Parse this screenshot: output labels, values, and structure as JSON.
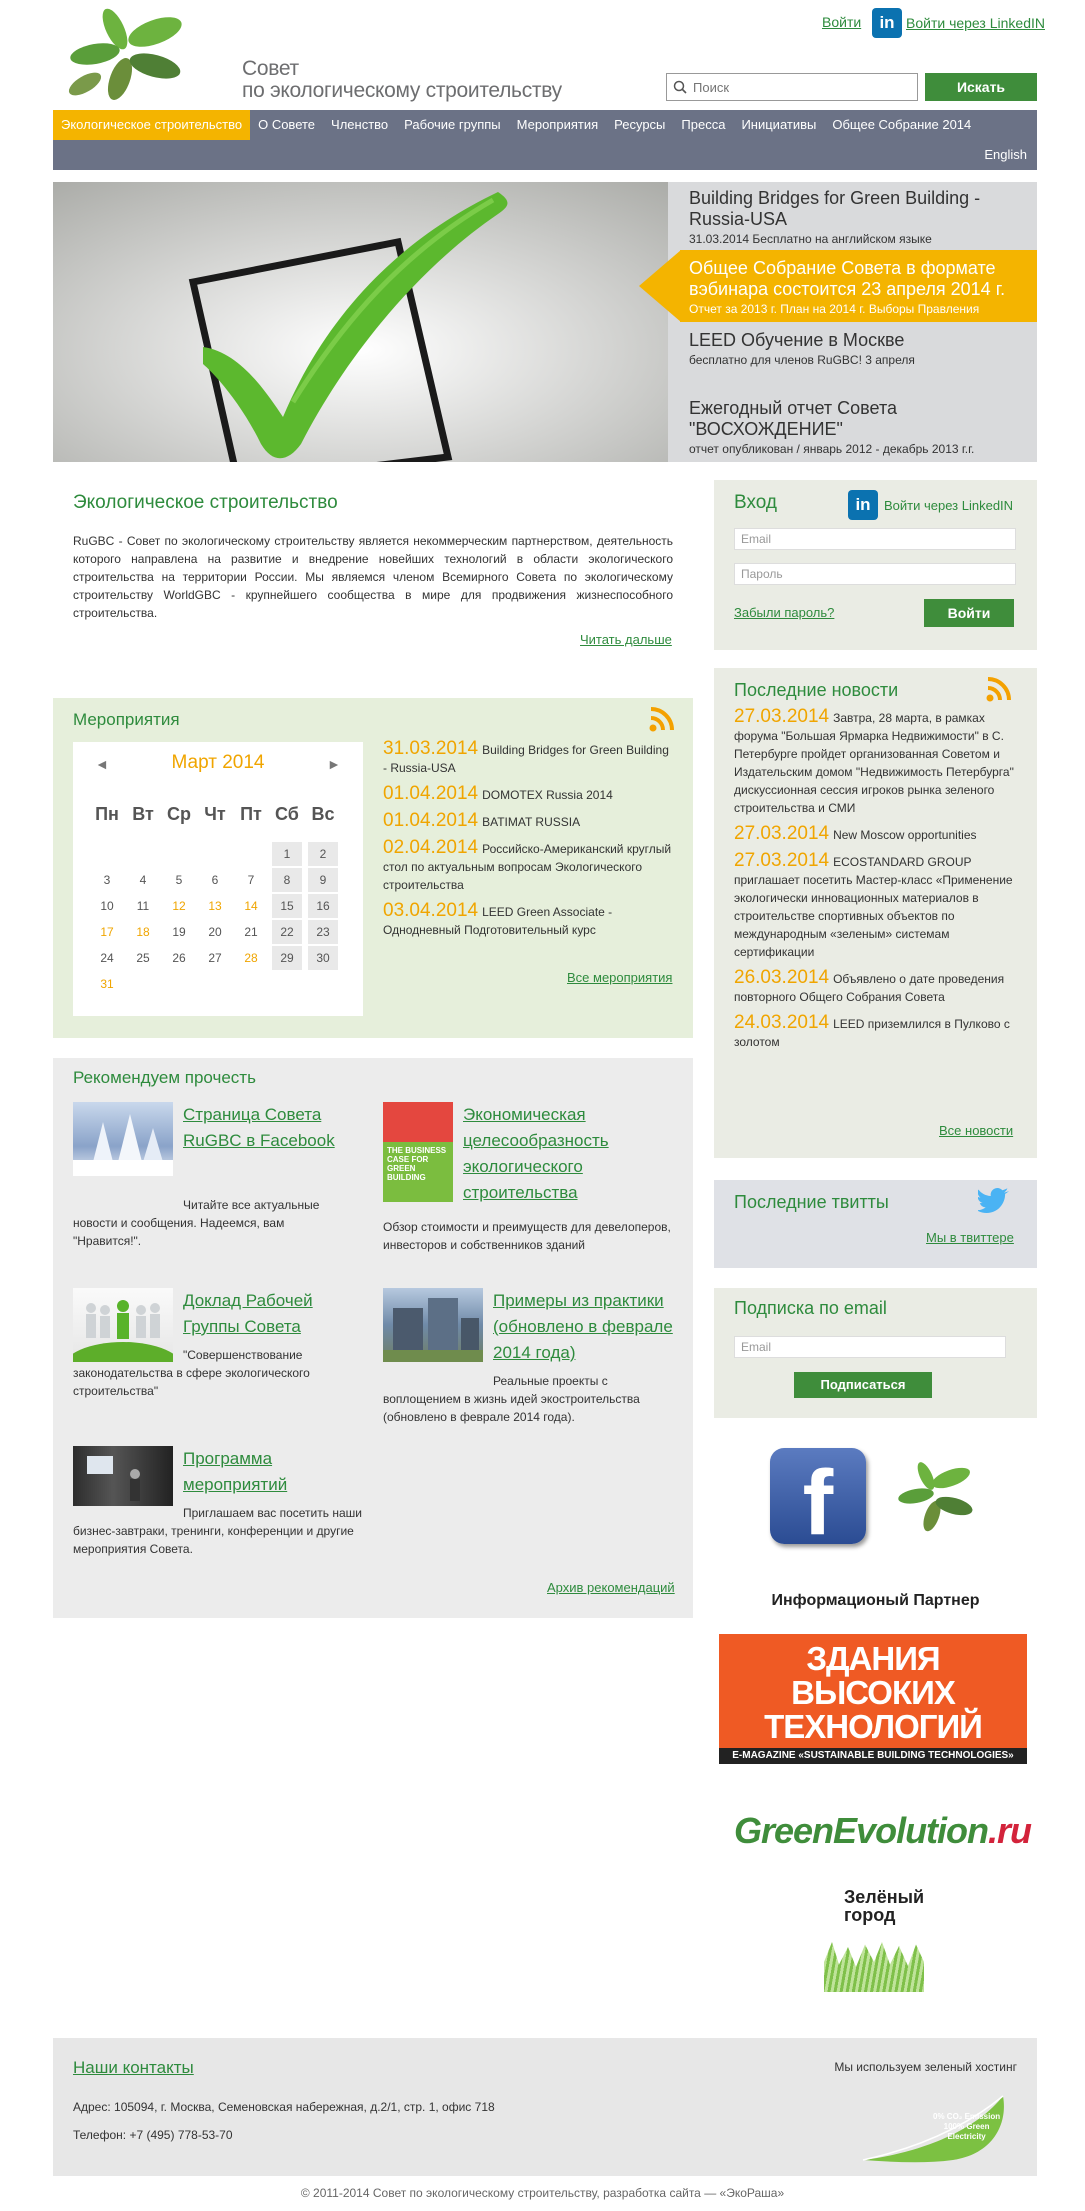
{
  "header": {
    "logo_line1": "Совет",
    "logo_line2": "по экологическому строительству",
    "login_link": "Войти",
    "linkedin_link": "Войти через LinkedIN",
    "linkedin_badge": "in",
    "search_placeholder": "Поиск",
    "search_button": "Искать"
  },
  "nav": {
    "items": [
      {
        "label": "Экологическое строительство",
        "active": true
      },
      {
        "label": "О Совете"
      },
      {
        "label": "Членство"
      },
      {
        "label": "Рабочие группы"
      },
      {
        "label": "Мероприятия"
      },
      {
        "label": "Ресурсы"
      },
      {
        "label": "Пресса"
      },
      {
        "label": "Инициативы"
      },
      {
        "label": "Общее Собрание 2014"
      }
    ],
    "english": "English"
  },
  "banner": {
    "items": [
      {
        "title": "Building Bridges for Green Building - Russia-USA",
        "sub": "31.03.2014 Бесплатно на английском языке"
      },
      {
        "title": "Общее Собрание Совета в формате вэбинара состоится 23 апреля 2014 г.",
        "sub": "Отчет за 2013 г. План на 2014 г. Выборы Правления"
      },
      {
        "title": "LEED Обучение в Москве",
        "sub": "бесплатно для членов RuGBC! 3 апреля"
      },
      {
        "title": "Ежегодный отчет Совета \"ВОСХОЖДЕНИЕ\"",
        "sub": "отчет опубликован / январь 2012 - декабрь 2013 г.г."
      }
    ]
  },
  "about": {
    "title": "Экологическое строительство",
    "text": "RuGBC - Совет по экологическому строительству является некоммерческим партнерством, деятельность которого направлена на развитие и внедрение новейших технологий в области экологического строительства на территории России. Мы являемся членом Всемирного Совета по экологическому строительству WorldGBC - крупнейшего сообщества в мире для продвижения жизнеспособного строительства.",
    "read_more": "Читать дальше"
  },
  "login": {
    "title": "Вход",
    "linkedin": "Войти через LinkedIN",
    "email_placeholder": "Email",
    "password_placeholder": "Пароль",
    "forgot": "Забыли пароль?",
    "button": "Войти"
  },
  "events": {
    "title": "Мероприятия",
    "calendar": {
      "month": "Март 2014",
      "prev": "◄",
      "next": "►",
      "dow": [
        "Пн",
        "Вт",
        "Ср",
        "Чт",
        "Пт",
        "Сб",
        "Вс"
      ],
      "weeks": [
        [
          "",
          "",
          "",
          "",
          "",
          "1",
          "2"
        ],
        [
          "3",
          "4",
          "5",
          "6",
          "7",
          "8",
          "9"
        ],
        [
          "10",
          "11",
          "12",
          "13",
          "14",
          "15",
          "16"
        ],
        [
          "17",
          "18",
          "19",
          "20",
          "21",
          "22",
          "23"
        ],
        [
          "24",
          "25",
          "26",
          "27",
          "28",
          "29",
          "30"
        ],
        [
          "31",
          "",
          "",
          "",
          "",
          "",
          ""
        ]
      ],
      "event_days": [
        "12",
        "13",
        "14",
        "17",
        "18",
        "28",
        "31"
      ]
    },
    "list": [
      {
        "date": "31.03.2014",
        "text": "Building Bridges for Green Building - Russia-USA"
      },
      {
        "date": "01.04.2014",
        "text": "DOMOTEX Russia 2014"
      },
      {
        "date": "01.04.2014",
        "text": "BATIMAT RUSSIA"
      },
      {
        "date": "02.04.2014",
        "text": "Российско-Американский круглый стол по актуальным вопросам Экологического строительства"
      },
      {
        "date": "03.04.2014",
        "text": "LEED Green Associate - Однодневный Подготовительный курс"
      }
    ],
    "all": "Все мероприятия"
  },
  "news": {
    "title": "Последние новости",
    "items": [
      {
        "date": "27.03.2014",
        "text": "Завтра, 28 марта, в рамках форума \"Большая Ярмарка Недвижимости\" в С. Петербурге пройдет организованная Советом и Издательским домом \"Недвижимость Петербурга\" дискуссионная сессия игроков рынка зеленого строительства и СМИ"
      },
      {
        "date": "27.03.2014",
        "text": "New Moscow opportunities"
      },
      {
        "date": "27.03.2014",
        "text": "ECOSTANDARD GROUP приглашает посетить Мастер-класс «Применение экологически инновационных материалов в строительстве спортивных объектов по международным «зеленым» системам сертификации"
      },
      {
        "date": "26.03.2014",
        "text": "Объявлено о дате проведения повторного Общего Собрания Совета"
      },
      {
        "date": "24.03.2014",
        "text": "LEED приземлился в Пулково с золотом"
      }
    ],
    "all": "Все новости"
  },
  "tweets": {
    "title": "Последние твитты",
    "link": "Мы в твиттере"
  },
  "subscribe": {
    "title": "Подписка по email",
    "email_placeholder": "Email",
    "button": "Подписаться"
  },
  "recommend": {
    "title": "Рекомендуем прочесть",
    "items": [
      {
        "link": "Страница Совета RuGBC в Facebook",
        "desc": "Читайте все актуальные новости и сообщения. Надеемся, вам \"Нравится!\"."
      },
      {
        "link": "Экономическая целесообразность экологического строительства",
        "desc": "Обзор стоимости и преимуществ для девелоперов, инвесторов и собственников зданий"
      },
      {
        "link": "Доклад Рабочей Группы Совета",
        "desc": "\"Совершенствование законодательства в сфере экологического строительства\""
      },
      {
        "link": "Примеры из практики (обновлено в феврале 2014 года)",
        "desc": "Реальные проекты с воплощением в жизнь идей экостроительства (обновлено в феврале 2014 года)."
      },
      {
        "link": "Программа мероприятий",
        "desc": "Приглашаем вас посетить наши бизнес-завтраки, тренинги, конференции и другие мероприятия Совета."
      }
    ],
    "book_cover_text": "THE BUSINESS CASE FOR GREEN BUILDING",
    "archive": "Архив рекомендаций"
  },
  "partners": {
    "facebook_glyph": "f",
    "info_partner": "Информационый Партнер",
    "zvt_line1": "ЗДАНИЯ",
    "zvt_line2": "ВЫСОКИХ",
    "zvt_line3": "ТЕХНОЛОГИЙ",
    "zvt_bar": "E-MAGAZINE «SUSTAINABLE BUILDING TECHNOLOGIES»",
    "ge_part1": "GreenEvolution",
    "ge_part2": ".ru",
    "zg_line1": "Зелёный",
    "zg_line2": "город"
  },
  "footer": {
    "title": "Наши контакты",
    "address": "Адрес: 105094, г. Москва, Семеновская набережная, д.2/1, стр. 1, офис 718",
    "phone": "Телефон: +7 (495) 778-53-70",
    "hosting": "Мы используем зеленый хостинг",
    "leaf_line1": "0% CO₂ Emission",
    "leaf_line2": "100% Green",
    "leaf_line3": "Electricity",
    "copyright": "© 2011-2014 Совет по экологическому строительству, разработка сайта — «ЭкоРаша»"
  },
  "colors": {
    "brand_green": "#3f8d3b",
    "link_green": "#2e8b3d",
    "accent_orange": "#f4b400",
    "nav_bg": "#6b7286"
  }
}
